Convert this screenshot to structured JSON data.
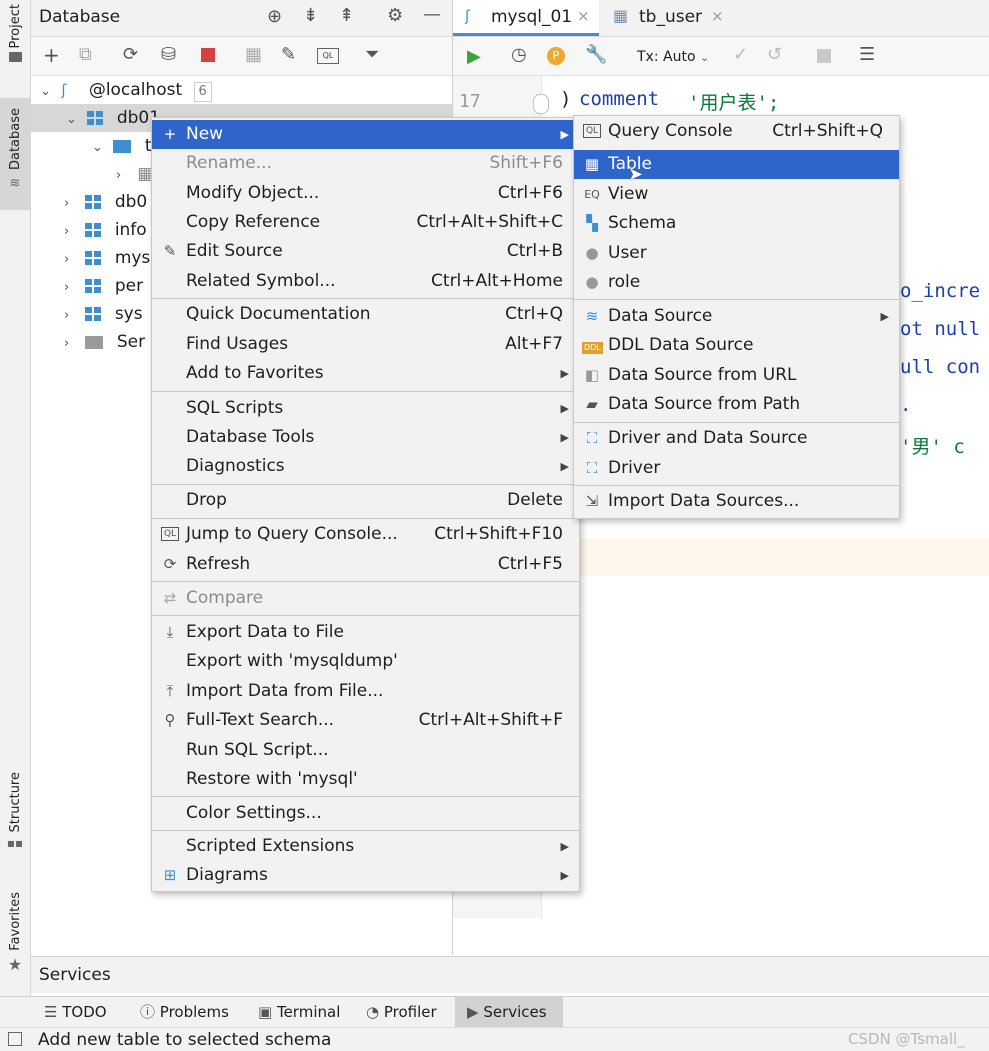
{
  "left_stripe": {
    "project": "Project",
    "database": "Database",
    "structure": "Structure",
    "favorites": "Favorites"
  },
  "db_panel": {
    "title": "Database",
    "tree": [
      {
        "label": "@localhost",
        "badge": "6"
      },
      {
        "label": "db01"
      },
      {
        "label": "t"
      },
      {
        "label": ""
      },
      {
        "label": "db0"
      },
      {
        "label": "info"
      },
      {
        "label": "mys"
      },
      {
        "label": "per"
      },
      {
        "label": "sys"
      },
      {
        "label": "Ser"
      }
    ]
  },
  "editor": {
    "tabs": [
      {
        "label": "mysql_01"
      },
      {
        "label": "tb_user"
      }
    ],
    "tx_mode": "Tx: Auto",
    "line_number": "17",
    "code_line": {
      "paren": ")",
      "keyword": "comment",
      "string": "'用户表';"
    },
    "fragments": [
      "o_incre",
      "ot null",
      "ull con",
      ".",
      "'男' c"
    ]
  },
  "context_menu": {
    "items": [
      {
        "label": "New",
        "shortcut": "",
        "submenu": true,
        "selected": true
      },
      {
        "label": "Rename...",
        "shortcut": "Shift+F6",
        "disabled": true
      },
      {
        "label": "Modify Object...",
        "shortcut": "Ctrl+F6"
      },
      {
        "label": "Copy Reference",
        "shortcut": "Ctrl+Alt+Shift+C"
      },
      {
        "label": "Edit Source",
        "shortcut": "Ctrl+B"
      },
      {
        "label": "Related Symbol...",
        "shortcut": "Ctrl+Alt+Home"
      },
      {
        "label": "Quick Documentation",
        "shortcut": "Ctrl+Q"
      },
      {
        "label": "Find Usages",
        "shortcut": "Alt+F7"
      },
      {
        "label": "Add to Favorites",
        "shortcut": "",
        "submenu": true
      },
      {
        "label": "SQL Scripts",
        "shortcut": "",
        "submenu": true
      },
      {
        "label": "Database Tools",
        "shortcut": "",
        "submenu": true
      },
      {
        "label": "Diagnostics",
        "shortcut": "",
        "submenu": true
      },
      {
        "label": "Drop",
        "shortcut": "Delete"
      },
      {
        "label": "Jump to Query Console...",
        "shortcut": "Ctrl+Shift+F10"
      },
      {
        "label": "Refresh",
        "shortcut": "Ctrl+F5"
      },
      {
        "label": "Compare",
        "shortcut": "",
        "disabled": true
      },
      {
        "label": "Export Data to File",
        "shortcut": ""
      },
      {
        "label": "Export with 'mysqldump'",
        "shortcut": ""
      },
      {
        "label": "Import Data from File...",
        "shortcut": ""
      },
      {
        "label": "Full-Text Search...",
        "shortcut": "Ctrl+Alt+Shift+F"
      },
      {
        "label": "Run SQL Script...",
        "shortcut": ""
      },
      {
        "label": "Restore with 'mysql'",
        "shortcut": ""
      },
      {
        "label": "Color Settings...",
        "shortcut": ""
      },
      {
        "label": "Scripted Extensions",
        "shortcut": "",
        "submenu": true
      },
      {
        "label": "Diagrams",
        "shortcut": "",
        "submenu": true
      }
    ]
  },
  "new_submenu": {
    "items": [
      {
        "label": "Query Console",
        "shortcut": "Ctrl+Shift+Q"
      },
      {
        "label": "Table",
        "shortcut": "",
        "selected": true
      },
      {
        "label": "View",
        "shortcut": ""
      },
      {
        "label": "Schema",
        "shortcut": ""
      },
      {
        "label": "User",
        "shortcut": ""
      },
      {
        "label": "role",
        "shortcut": ""
      },
      {
        "label": "Data Source",
        "shortcut": "",
        "submenu": true
      },
      {
        "label": "DDL Data Source",
        "shortcut": ""
      },
      {
        "label": "Data Source from URL",
        "shortcut": ""
      },
      {
        "label": "Data Source from Path",
        "shortcut": ""
      },
      {
        "label": "Driver and Data Source",
        "shortcut": ""
      },
      {
        "label": "Driver",
        "shortcut": ""
      },
      {
        "label": "Import Data Sources...",
        "shortcut": ""
      }
    ]
  },
  "services_bar": {
    "label": "Services"
  },
  "bottom_tabs": [
    {
      "label": "TODO"
    },
    {
      "label": "Problems"
    },
    {
      "label": "Terminal"
    },
    {
      "label": "Profiler"
    },
    {
      "label": "Services",
      "active": true
    }
  ],
  "status": {
    "message": "Add new table to selected schema",
    "watermark": "CSDN @Tsmall_"
  },
  "colors": {
    "selection": "#2f65ca",
    "db_icon": "#3d8fd1",
    "keyword": "#1a3fb3",
    "string": "#0b7a3a"
  }
}
